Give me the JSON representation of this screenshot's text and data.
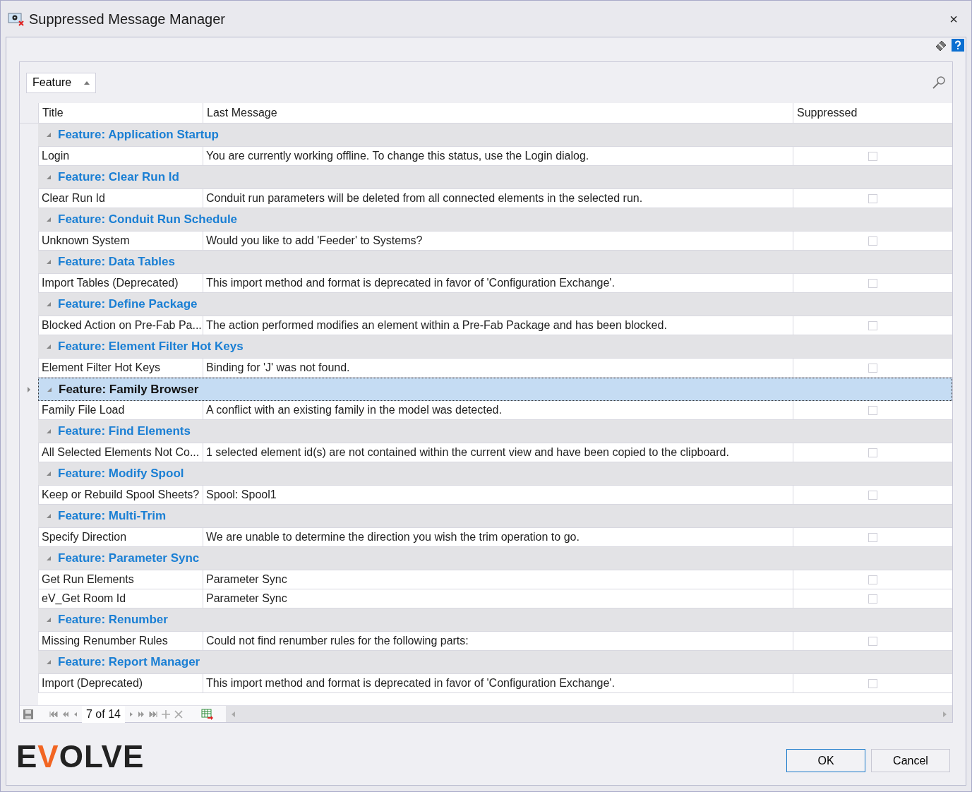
{
  "window": {
    "title": "Suppressed Message Manager",
    "close": "×"
  },
  "group_by": {
    "label": "Feature"
  },
  "table": {
    "columns": [
      "Title",
      "Last Message",
      "Suppressed"
    ],
    "groups": [
      {
        "title": "Feature: Application Startup",
        "expanded": true,
        "selected": false,
        "rows": [
          {
            "title": "Login",
            "message": "You are currently working offline. To change this status, use the Login dialog.",
            "suppressed": false
          }
        ]
      },
      {
        "title": "Feature: Clear Run Id",
        "expanded": true,
        "selected": false,
        "rows": [
          {
            "title": "Clear Run Id",
            "message": "Conduit run parameters will be deleted from all connected elements in the selected run.",
            "suppressed": false
          }
        ]
      },
      {
        "title": "Feature: Conduit Run Schedule",
        "expanded": true,
        "selected": false,
        "rows": [
          {
            "title": "Unknown System",
            "message": "Would you like to add 'Feeder' to Systems?",
            "suppressed": false
          }
        ]
      },
      {
        "title": "Feature: Data Tables",
        "expanded": true,
        "selected": false,
        "rows": [
          {
            "title": "Import Tables (Deprecated)",
            "message": "This import method and format is deprecated in favor of 'Configuration Exchange'.",
            "suppressed": false
          }
        ]
      },
      {
        "title": "Feature: Define Package",
        "expanded": true,
        "selected": false,
        "rows": [
          {
            "title": "Blocked Action on Pre-Fab Pa...",
            "message": "The action performed modifies an element within a Pre-Fab Package and has been blocked.",
            "suppressed": false
          }
        ]
      },
      {
        "title": "Feature: Element Filter Hot Keys",
        "expanded": true,
        "selected": false,
        "rows": [
          {
            "title": "Element Filter Hot Keys",
            "message": "Binding for 'J' was not found.",
            "suppressed": false
          }
        ]
      },
      {
        "title": "Feature: Family Browser",
        "expanded": true,
        "selected": true,
        "rows": [
          {
            "title": "Family File Load",
            "message": "A conflict with an existing family in the model was detected.",
            "suppressed": false
          }
        ]
      },
      {
        "title": "Feature: Find Elements",
        "expanded": true,
        "selected": false,
        "rows": [
          {
            "title": "All Selected Elements Not Co...",
            "message": "1 selected element id(s) are not contained within the current view and have been copied to the clipboard.",
            "suppressed": false
          }
        ]
      },
      {
        "title": "Feature: Modify Spool",
        "expanded": true,
        "selected": false,
        "rows": [
          {
            "title": "Keep or Rebuild Spool Sheets?",
            "message": "Spool: Spool1",
            "suppressed": false
          }
        ]
      },
      {
        "title": "Feature: Multi-Trim",
        "expanded": true,
        "selected": false,
        "rows": [
          {
            "title": "Specify Direction",
            "message": "We are unable to determine the direction you wish the trim operation to go.",
            "suppressed": false
          }
        ]
      },
      {
        "title": "Feature: Parameter Sync",
        "expanded": true,
        "selected": false,
        "rows": [
          {
            "title": "Get Run Elements",
            "message": "Parameter Sync",
            "suppressed": false
          },
          {
            "title": "eV_Get Room Id",
            "message": "Parameter Sync",
            "suppressed": false
          }
        ]
      },
      {
        "title": "Feature: Renumber",
        "expanded": true,
        "selected": false,
        "rows": [
          {
            "title": "Missing Renumber Rules",
            "message": "Could not find renumber rules for the following parts:",
            "suppressed": false
          }
        ]
      },
      {
        "title": "Feature: Report Manager",
        "expanded": true,
        "selected": false,
        "rows": [
          {
            "title": "Import (Deprecated)",
            "message": "This import method and format is deprecated in favor of 'Configuration Exchange'.",
            "suppressed": false
          }
        ]
      }
    ]
  },
  "navigator": {
    "position": "7 of 14"
  },
  "logo": "EVOLVE",
  "buttons": [
    {
      "label": "OK",
      "kind": "default"
    },
    {
      "label": "Cancel",
      "kind": "normal"
    }
  ]
}
